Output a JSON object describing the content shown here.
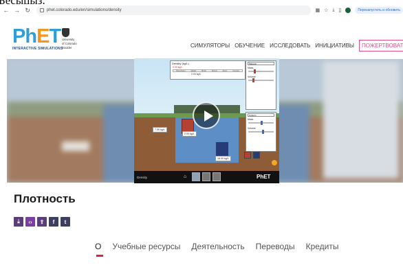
{
  "caption": "Бeсыцыз.",
  "browser": {
    "url": "phet.colorado.edu/en/simulations/density",
    "relaunch_label": "Перезапустить и обновить"
  },
  "site": {
    "logo_text_ph": "Ph",
    "logo_text_e": "E",
    "logo_text_t": "T",
    "logo_subtitle": "INTERACTIVE SIMULATIONS",
    "university_lines": [
      "University",
      "of Colorado",
      "Boulder"
    ],
    "nav": [
      "СИМУЛЯТОРЫ",
      "ОБУЧЕНИЕ",
      "ИССЛЕДОВАТЬ",
      "ИНИЦИАТИВЫ"
    ],
    "donate_label": "ПОЖЕРТВОВАТЬ"
  },
  "sim": {
    "density_panel_title": "Density (kg/L)",
    "density_scale": [
      "Styrofoam",
      "Water",
      "Brick",
      "Wood",
      "Alum",
      "Copper"
    ],
    "density_value": "0.90 kg/L",
    "density_value2": "2.00 kg/L",
    "block_label_a": "7.00 kg/L",
    "block_label_b": "2.00 kg/L",
    "block_label_c": "18.00 kg/L",
    "panel_material": "Material",
    "panel_mass": "Mass",
    "panel_volume": "Volume",
    "panel2_material": "Custom",
    "bar_title": "Density",
    "phet_mark": "PhET"
  },
  "page": {
    "title": "Плотность",
    "share": [
      "download",
      "embed",
      "share",
      "facebook",
      "twitter"
    ]
  },
  "tabs": [
    "О",
    "Учебные ресурсы",
    "Деятельность",
    "Переводы",
    "Кредиты"
  ],
  "icons": [
    "back-icon",
    "forward-icon",
    "reload-icon",
    "search-icon",
    "user-icon",
    "play-icon",
    "home-icon"
  ]
}
